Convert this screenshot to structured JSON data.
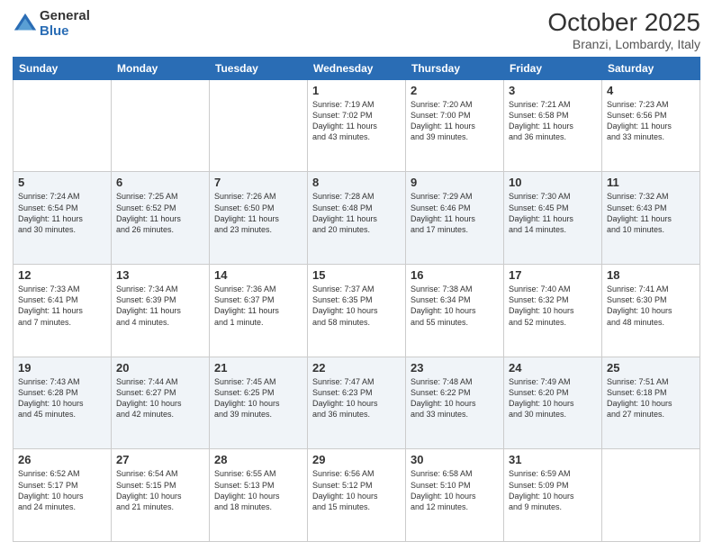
{
  "header": {
    "logo_general": "General",
    "logo_blue": "Blue",
    "title": "October 2025",
    "subtitle": "Branzi, Lombardy, Italy"
  },
  "weekdays": [
    "Sunday",
    "Monday",
    "Tuesday",
    "Wednesday",
    "Thursday",
    "Friday",
    "Saturday"
  ],
  "weeks": [
    [
      {
        "day": "",
        "info": ""
      },
      {
        "day": "",
        "info": ""
      },
      {
        "day": "",
        "info": ""
      },
      {
        "day": "1",
        "info": "Sunrise: 7:19 AM\nSunset: 7:02 PM\nDaylight: 11 hours\nand 43 minutes."
      },
      {
        "day": "2",
        "info": "Sunrise: 7:20 AM\nSunset: 7:00 PM\nDaylight: 11 hours\nand 39 minutes."
      },
      {
        "day": "3",
        "info": "Sunrise: 7:21 AM\nSunset: 6:58 PM\nDaylight: 11 hours\nand 36 minutes."
      },
      {
        "day": "4",
        "info": "Sunrise: 7:23 AM\nSunset: 6:56 PM\nDaylight: 11 hours\nand 33 minutes."
      }
    ],
    [
      {
        "day": "5",
        "info": "Sunrise: 7:24 AM\nSunset: 6:54 PM\nDaylight: 11 hours\nand 30 minutes."
      },
      {
        "day": "6",
        "info": "Sunrise: 7:25 AM\nSunset: 6:52 PM\nDaylight: 11 hours\nand 26 minutes."
      },
      {
        "day": "7",
        "info": "Sunrise: 7:26 AM\nSunset: 6:50 PM\nDaylight: 11 hours\nand 23 minutes."
      },
      {
        "day": "8",
        "info": "Sunrise: 7:28 AM\nSunset: 6:48 PM\nDaylight: 11 hours\nand 20 minutes."
      },
      {
        "day": "9",
        "info": "Sunrise: 7:29 AM\nSunset: 6:46 PM\nDaylight: 11 hours\nand 17 minutes."
      },
      {
        "day": "10",
        "info": "Sunrise: 7:30 AM\nSunset: 6:45 PM\nDaylight: 11 hours\nand 14 minutes."
      },
      {
        "day": "11",
        "info": "Sunrise: 7:32 AM\nSunset: 6:43 PM\nDaylight: 11 hours\nand 10 minutes."
      }
    ],
    [
      {
        "day": "12",
        "info": "Sunrise: 7:33 AM\nSunset: 6:41 PM\nDaylight: 11 hours\nand 7 minutes."
      },
      {
        "day": "13",
        "info": "Sunrise: 7:34 AM\nSunset: 6:39 PM\nDaylight: 11 hours\nand 4 minutes."
      },
      {
        "day": "14",
        "info": "Sunrise: 7:36 AM\nSunset: 6:37 PM\nDaylight: 11 hours\nand 1 minute."
      },
      {
        "day": "15",
        "info": "Sunrise: 7:37 AM\nSunset: 6:35 PM\nDaylight: 10 hours\nand 58 minutes."
      },
      {
        "day": "16",
        "info": "Sunrise: 7:38 AM\nSunset: 6:34 PM\nDaylight: 10 hours\nand 55 minutes."
      },
      {
        "day": "17",
        "info": "Sunrise: 7:40 AM\nSunset: 6:32 PM\nDaylight: 10 hours\nand 52 minutes."
      },
      {
        "day": "18",
        "info": "Sunrise: 7:41 AM\nSunset: 6:30 PM\nDaylight: 10 hours\nand 48 minutes."
      }
    ],
    [
      {
        "day": "19",
        "info": "Sunrise: 7:43 AM\nSunset: 6:28 PM\nDaylight: 10 hours\nand 45 minutes."
      },
      {
        "day": "20",
        "info": "Sunrise: 7:44 AM\nSunset: 6:27 PM\nDaylight: 10 hours\nand 42 minutes."
      },
      {
        "day": "21",
        "info": "Sunrise: 7:45 AM\nSunset: 6:25 PM\nDaylight: 10 hours\nand 39 minutes."
      },
      {
        "day": "22",
        "info": "Sunrise: 7:47 AM\nSunset: 6:23 PM\nDaylight: 10 hours\nand 36 minutes."
      },
      {
        "day": "23",
        "info": "Sunrise: 7:48 AM\nSunset: 6:22 PM\nDaylight: 10 hours\nand 33 minutes."
      },
      {
        "day": "24",
        "info": "Sunrise: 7:49 AM\nSunset: 6:20 PM\nDaylight: 10 hours\nand 30 minutes."
      },
      {
        "day": "25",
        "info": "Sunrise: 7:51 AM\nSunset: 6:18 PM\nDaylight: 10 hours\nand 27 minutes."
      }
    ],
    [
      {
        "day": "26",
        "info": "Sunrise: 6:52 AM\nSunset: 5:17 PM\nDaylight: 10 hours\nand 24 minutes."
      },
      {
        "day": "27",
        "info": "Sunrise: 6:54 AM\nSunset: 5:15 PM\nDaylight: 10 hours\nand 21 minutes."
      },
      {
        "day": "28",
        "info": "Sunrise: 6:55 AM\nSunset: 5:13 PM\nDaylight: 10 hours\nand 18 minutes."
      },
      {
        "day": "29",
        "info": "Sunrise: 6:56 AM\nSunset: 5:12 PM\nDaylight: 10 hours\nand 15 minutes."
      },
      {
        "day": "30",
        "info": "Sunrise: 6:58 AM\nSunset: 5:10 PM\nDaylight: 10 hours\nand 12 minutes."
      },
      {
        "day": "31",
        "info": "Sunrise: 6:59 AM\nSunset: 5:09 PM\nDaylight: 10 hours\nand 9 minutes."
      },
      {
        "day": "",
        "info": ""
      }
    ]
  ]
}
